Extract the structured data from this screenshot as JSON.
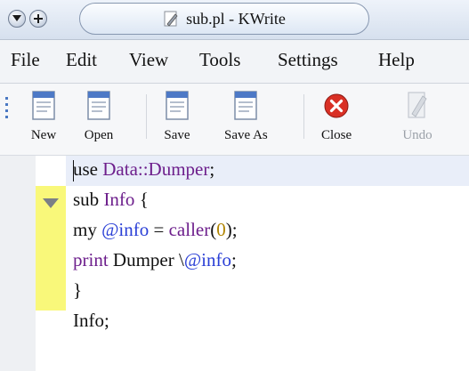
{
  "window": {
    "title": "sub.pl - KWrite"
  },
  "titlebar_buttons": [
    "menu-icon",
    "maximize-icon"
  ],
  "menubar": {
    "items": [
      {
        "label": "File"
      },
      {
        "label": "Edit"
      },
      {
        "label": "View"
      },
      {
        "label": "Tools"
      },
      {
        "label": "Settings"
      },
      {
        "label": "Help"
      }
    ]
  },
  "toolbar": {
    "new_label": "New",
    "open_label": "Open",
    "save_label": "Save",
    "saveas_label": "Save As",
    "close_label": "Close",
    "undo_label": "Undo"
  },
  "editor": {
    "lines": [
      {
        "parts": [
          {
            "t": "use ",
            "c": "plain"
          },
          {
            "t": "Data::Dumper",
            "c": "kw"
          },
          {
            "t": ";",
            "c": "plain"
          }
        ]
      },
      {
        "parts": [
          {
            "t": "sub ",
            "c": "plain"
          },
          {
            "t": "Info",
            "c": "kw"
          },
          {
            "t": " {",
            "c": "plain"
          }
        ]
      },
      {
        "parts": [
          {
            "t": "my ",
            "c": "plain"
          },
          {
            "t": "@info",
            "c": "var"
          },
          {
            "t": " = ",
            "c": "plain"
          },
          {
            "t": "caller",
            "c": "kw"
          },
          {
            "t": "(",
            "c": "plain"
          },
          {
            "t": "0",
            "c": "num"
          },
          {
            "t": ");",
            "c": "plain"
          }
        ]
      },
      {
        "parts": [
          {
            "t": "print",
            "c": "kw"
          },
          {
            "t": " Dumper \\",
            "c": "plain"
          },
          {
            "t": "@info",
            "c": "var"
          },
          {
            "t": ";",
            "c": "plain"
          }
        ]
      },
      {
        "parts": [
          {
            "t": "}",
            "c": "plain"
          }
        ]
      },
      {
        "parts": [
          {
            "t": "Info;",
            "c": "plain"
          }
        ]
      }
    ]
  },
  "colors": {
    "keyword": "#6d1f8c",
    "variable": "#2a3fd6",
    "number": "#b08400",
    "fold_bar": "#f9f87a",
    "current_line": "#e9eef9",
    "close_icon": "#d93025"
  }
}
